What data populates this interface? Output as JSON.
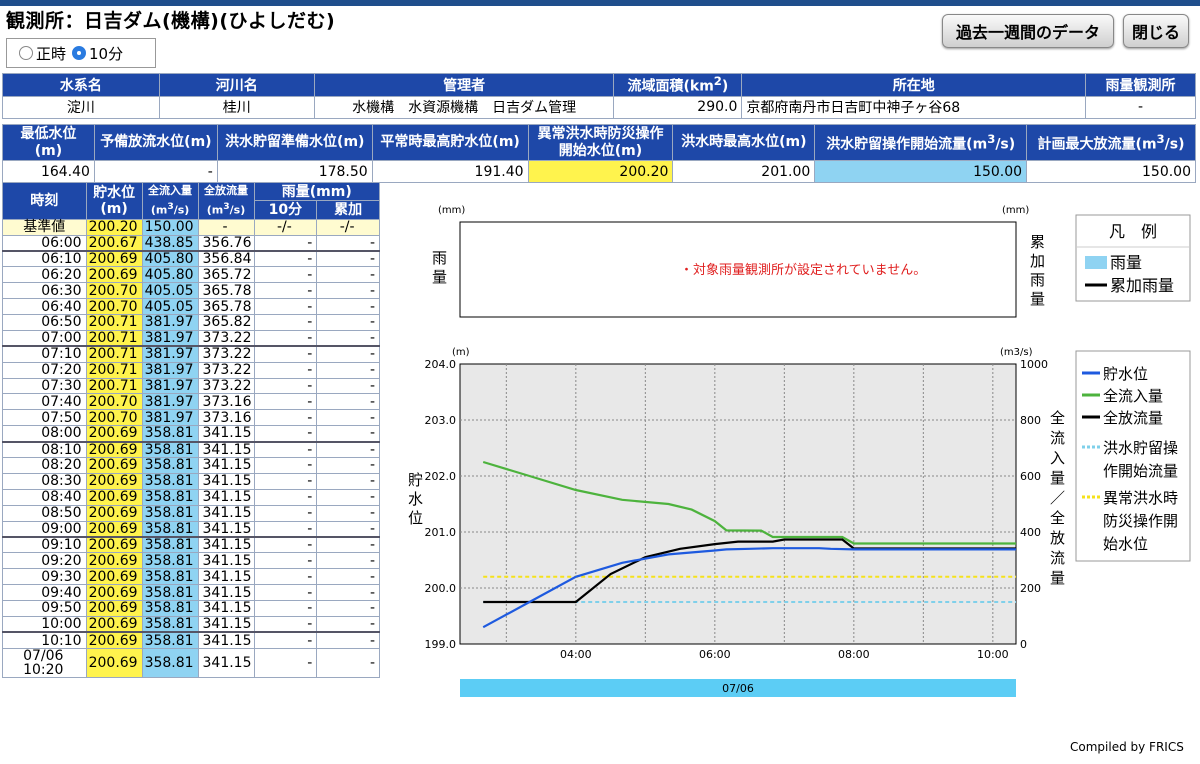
{
  "title": "観測所：日吉ダム(機構)(ひよしだむ)",
  "radio": {
    "option1": "正時",
    "option2": "10分",
    "selected": "10分"
  },
  "buttons": {
    "week": "過去一週間のデータ",
    "close": "閉じる"
  },
  "info1": {
    "headers": [
      "水系名",
      "河川名",
      "管理者",
      "流域面積(km²)",
      "所在地",
      "雨量観測所"
    ],
    "values": [
      "淀川",
      "桂川",
      "水機構　水資源機構　日吉ダム管理",
      "290.0",
      "京都府南丹市日吉町中神子ヶ谷68",
      "-"
    ]
  },
  "info2": {
    "headers": [
      "最低水位(m)",
      "予備放流水位(m)",
      "洪水貯留準備水位(m)",
      "平常時最高貯水位(m)",
      "異常洪水時防災操作開始水位(m)",
      "洪水時最高水位(m)",
      "洪水貯留操作開始流量(m³/s)",
      "計画最大放流量(m³/s)"
    ],
    "values": [
      "164.40",
      "-",
      "178.50",
      "191.40",
      "200.20",
      "201.00",
      "150.00",
      "150.00"
    ]
  },
  "table": {
    "h_time": "時刻",
    "h_level": "貯水位(m)",
    "h_inflow": "全流入量(m³/s)",
    "h_outflow": "全放流量(m³/s)",
    "h_rain": "雨量(mm)",
    "h_10min": "10分",
    "h_cum": "累加",
    "base": {
      "label": "基準値",
      "level": "200.20",
      "inflow": "150.00",
      "outflow": "-",
      "r10": "-/-",
      "cum": "-/-"
    },
    "rows": [
      [
        "06:00",
        "200.67",
        "438.85",
        "356.76",
        "-",
        "-"
      ],
      [
        "06:10",
        "200.69",
        "405.80",
        "356.84",
        "-",
        "-"
      ],
      [
        "06:20",
        "200.69",
        "405.80",
        "365.72",
        "-",
        "-"
      ],
      [
        "06:30",
        "200.70",
        "405.05",
        "365.78",
        "-",
        "-"
      ],
      [
        "06:40",
        "200.70",
        "405.05",
        "365.78",
        "-",
        "-"
      ],
      [
        "06:50",
        "200.71",
        "381.97",
        "365.82",
        "-",
        "-"
      ],
      [
        "07:00",
        "200.71",
        "381.97",
        "373.22",
        "-",
        "-"
      ],
      [
        "07:10",
        "200.71",
        "381.97",
        "373.22",
        "-",
        "-"
      ],
      [
        "07:20",
        "200.71",
        "381.97",
        "373.22",
        "-",
        "-"
      ],
      [
        "07:30",
        "200.71",
        "381.97",
        "373.22",
        "-",
        "-"
      ],
      [
        "07:40",
        "200.70",
        "381.97",
        "373.16",
        "-",
        "-"
      ],
      [
        "07:50",
        "200.70",
        "381.97",
        "373.16",
        "-",
        "-"
      ],
      [
        "08:00",
        "200.69",
        "358.81",
        "341.15",
        "-",
        "-"
      ],
      [
        "08:10",
        "200.69",
        "358.81",
        "341.15",
        "-",
        "-"
      ],
      [
        "08:20",
        "200.69",
        "358.81",
        "341.15",
        "-",
        "-"
      ],
      [
        "08:30",
        "200.69",
        "358.81",
        "341.15",
        "-",
        "-"
      ],
      [
        "08:40",
        "200.69",
        "358.81",
        "341.15",
        "-",
        "-"
      ],
      [
        "08:50",
        "200.69",
        "358.81",
        "341.15",
        "-",
        "-"
      ],
      [
        "09:00",
        "200.69",
        "358.81",
        "341.15",
        "-",
        "-"
      ],
      [
        "09:10",
        "200.69",
        "358.81",
        "341.15",
        "-",
        "-"
      ],
      [
        "09:20",
        "200.69",
        "358.81",
        "341.15",
        "-",
        "-"
      ],
      [
        "09:30",
        "200.69",
        "358.81",
        "341.15",
        "-",
        "-"
      ],
      [
        "09:40",
        "200.69",
        "358.81",
        "341.15",
        "-",
        "-"
      ],
      [
        "09:50",
        "200.69",
        "358.81",
        "341.15",
        "-",
        "-"
      ],
      [
        "10:00",
        "200.69",
        "358.81",
        "341.15",
        "-",
        "-"
      ],
      [
        "10:10",
        "200.69",
        "358.81",
        "341.15",
        "-",
        "-"
      ],
      [
        "07/06 10:20",
        "200.69",
        "358.81",
        "341.15",
        "-",
        "-"
      ]
    ]
  },
  "rain_chart": {
    "unit_left": "(mm)",
    "unit_right": "(mm)",
    "ylabel_left": "雨量",
    "ylabel_right": "累加雨量",
    "message": "・対象雨量観測所が設定されていません。",
    "legend_title": "凡　例",
    "legend": [
      "雨量",
      "累加雨量"
    ],
    "colors": {
      "rain": "#8fd3f2",
      "cum": "#000000"
    }
  },
  "chart_data": {
    "type": "line",
    "x_tick_labels": [
      "04:00",
      "06:00",
      "08:00",
      "10:00"
    ],
    "date_label": "07/06",
    "y_left": {
      "label": "貯水位",
      "unit": "(m)",
      "range": [
        199.0,
        204.0
      ],
      "ticks": [
        "199.0",
        "200.0",
        "201.0",
        "202.0",
        "203.0",
        "204.0"
      ]
    },
    "y_right": {
      "label": "全流入量／全放流量",
      "unit": "(m3/s)",
      "range": [
        0,
        1000
      ],
      "ticks": [
        "0",
        "200",
        "400",
        "600",
        "800",
        "1000"
      ]
    },
    "grid": true,
    "legend_position": "right",
    "series": [
      {
        "name": "貯水位",
        "axis": "left",
        "color": "#1e5adf",
        "points": [
          [
            "02:40",
            199.3
          ],
          [
            "03:20",
            199.75
          ],
          [
            "04:00",
            200.2
          ],
          [
            "04:40",
            200.45
          ],
          [
            "05:20",
            200.6
          ],
          [
            "06:00",
            200.67
          ],
          [
            "06:10",
            200.69
          ],
          [
            "06:30",
            200.7
          ],
          [
            "06:50",
            200.71
          ],
          [
            "07:30",
            200.71
          ],
          [
            "07:40",
            200.7
          ],
          [
            "08:00",
            200.69
          ],
          [
            "10:20",
            200.69
          ]
        ]
      },
      {
        "name": "全流入量",
        "axis": "right",
        "color": "#4db33d",
        "points": [
          [
            "02:40",
            650
          ],
          [
            "03:20",
            600
          ],
          [
            "04:00",
            550
          ],
          [
            "04:40",
            515
          ],
          [
            "05:20",
            500
          ],
          [
            "05:40",
            480
          ],
          [
            "06:00",
            438.85
          ],
          [
            "06:10",
            405.8
          ],
          [
            "06:40",
            405.05
          ],
          [
            "06:50",
            381.97
          ],
          [
            "07:50",
            381.97
          ],
          [
            "08:00",
            358.81
          ],
          [
            "10:20",
            358.81
          ]
        ]
      },
      {
        "name": "全放流量",
        "axis": "right",
        "color": "#000000",
        "points": [
          [
            "02:40",
            150
          ],
          [
            "03:20",
            150
          ],
          [
            "04:00",
            150
          ],
          [
            "04:30",
            250
          ],
          [
            "05:00",
            310
          ],
          [
            "05:30",
            340
          ],
          [
            "06:00",
            356.76
          ],
          [
            "06:20",
            365.72
          ],
          [
            "06:50",
            365.82
          ],
          [
            "07:00",
            373.22
          ],
          [
            "07:50",
            373.16
          ],
          [
            "08:00",
            341.15
          ],
          [
            "10:20",
            341.15
          ]
        ]
      },
      {
        "name": "洪水貯留操作開始流量",
        "axis": "right",
        "color": "#7fd0ea",
        "dashed": true,
        "points": [
          [
            "02:40",
            150
          ],
          [
            "10:20",
            150
          ]
        ]
      },
      {
        "name": "異常洪水時防災操作開始水位",
        "axis": "left",
        "color": "#f5e21a",
        "dashed": true,
        "points": [
          [
            "02:40",
            200.2
          ],
          [
            "10:20",
            200.2
          ]
        ]
      }
    ]
  },
  "credit": "Compiled by FRICS"
}
